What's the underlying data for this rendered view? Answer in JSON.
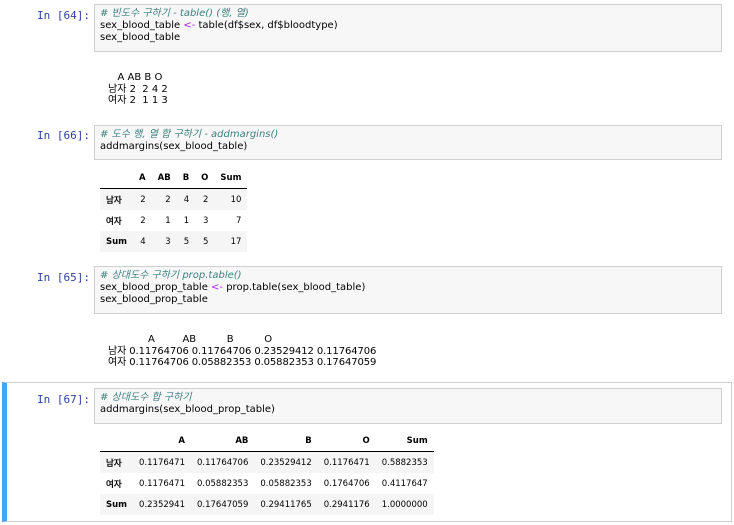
{
  "cells": [
    {
      "prompt": "In [64]:",
      "code": [
        {
          "comment": "# 빈도수 구하기 - table() (행, 열)"
        },
        {
          "pre": "sex_blood_table ",
          "op": "<-",
          "post": " table(df$sex, df$bloodtype)"
        },
        {
          "pre": "sex_blood_table"
        }
      ],
      "output_text": "   A AB B O\n남자 2  2 4 2\n여자 2  1 1 3"
    },
    {
      "prompt": "In [66]:",
      "code": [
        {
          "comment": "# 도수 행, 열 합 구하기 - addmargins()"
        },
        {
          "pre": "addmargins(sex_blood_table)"
        }
      ],
      "table": {
        "headers": [
          "",
          "A",
          "AB",
          "B",
          "O",
          "Sum"
        ],
        "rows": [
          [
            "남자",
            "2",
            "2",
            "4",
            "2",
            "10"
          ],
          [
            "여자",
            "2",
            "1",
            "1",
            "3",
            "7"
          ],
          [
            "Sum",
            "4",
            "3",
            "5",
            "5",
            "17"
          ]
        ]
      }
    },
    {
      "prompt": "In [65]:",
      "code": [
        {
          "comment": "# 상대도수 구하기 prop.table()"
        },
        {
          "pre": "sex_blood_prop_table ",
          "op": "<-",
          "post": " prop.table(sex_blood_table)"
        },
        {
          "pre": "sex_blood_prop_table"
        }
      ],
      "output_text": "             A         AB          B          O\n남자 0.11764706 0.11764706 0.23529412 0.11764706\n여자 0.11764706 0.05882353 0.05882353 0.17647059"
    },
    {
      "prompt": "In [67]:",
      "code": [
        {
          "comment": "# 상대도수 합 구하기"
        },
        {
          "pre": "addmargins(sex_blood_prop_table)"
        }
      ],
      "table": {
        "headers": [
          "",
          "A",
          "AB",
          "B",
          "O",
          "Sum"
        ],
        "rows": [
          [
            "남자",
            "0.1176471",
            "0.11764706",
            "0.23529412",
            "0.1176471",
            "0.5882353"
          ],
          [
            "여자",
            "0.1176471",
            "0.05882353",
            "0.05882353",
            "0.1764706",
            "0.4117647"
          ],
          [
            "Sum",
            "0.2352941",
            "0.17647059",
            "0.29411765",
            "0.2941176",
            "1.0000000"
          ]
        ]
      }
    }
  ]
}
